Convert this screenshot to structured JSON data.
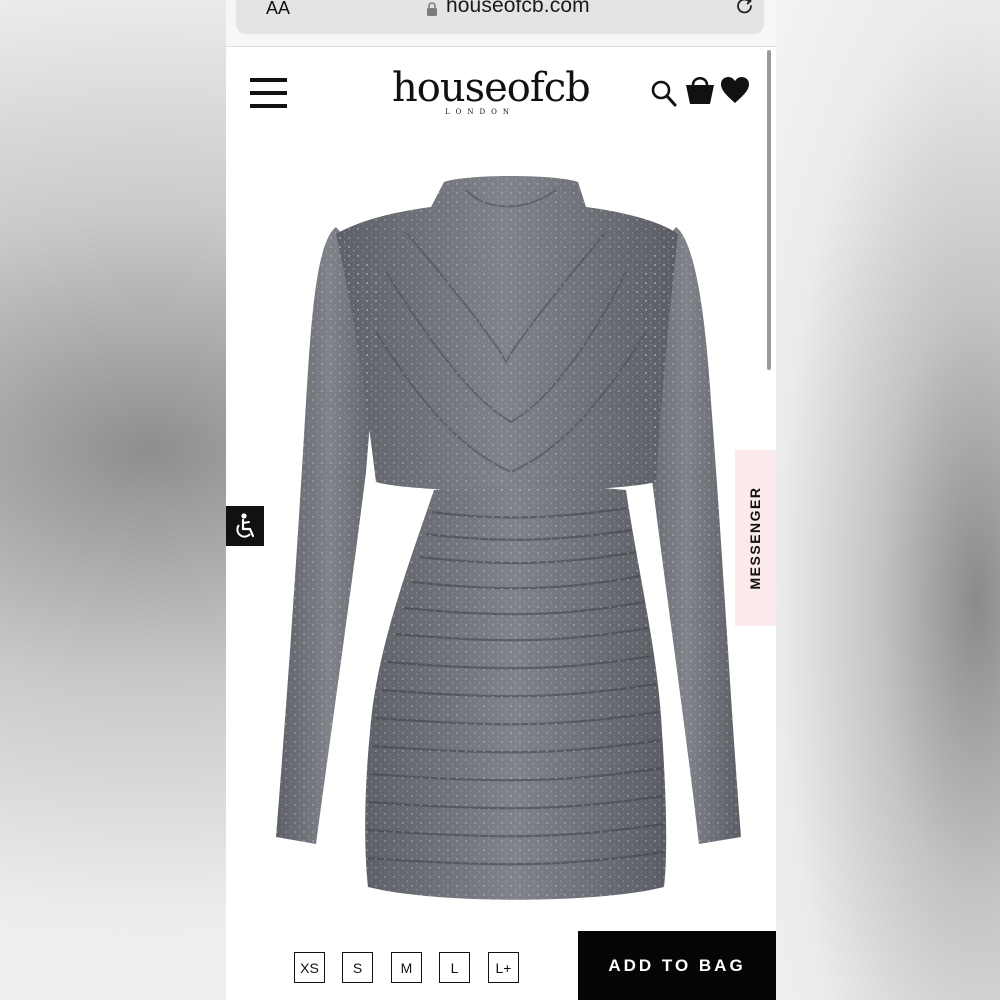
{
  "browser": {
    "text_size_label": "AA",
    "url": "houseofcb.com",
    "lock_icon": "lock-icon",
    "reload_icon": "reload-icon"
  },
  "header": {
    "menu_icon": "hamburger-menu-icon",
    "logo_text": "houseofcb",
    "logo_subtitle": "LONDON",
    "icons": [
      "search-icon",
      "shopping-bag-icon",
      "heart-icon"
    ]
  },
  "product": {
    "image": "product-photo"
  },
  "side_widgets": {
    "accessibility_icon": "accessibility-icon",
    "messenger_label": "MESSENGER"
  },
  "sizes": [
    "XS",
    "S",
    "M",
    "L",
    "L+"
  ],
  "actions": {
    "add_to_bag_label": "ADD TO BAG"
  },
  "colors": {
    "page": "#ffffff",
    "text": "#111111",
    "button_bg": "#050505",
    "button_text": "#ffffff",
    "messenger_bg": "#fbe9ec",
    "dress": "#6f7278"
  }
}
